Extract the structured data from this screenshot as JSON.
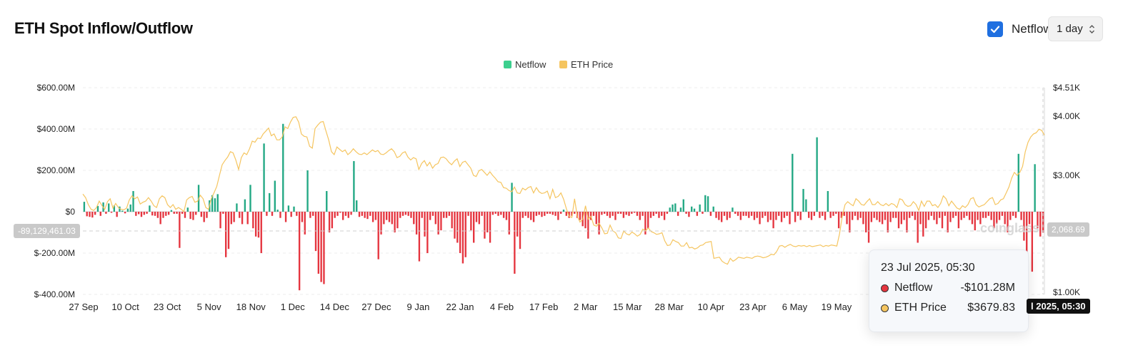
{
  "header": {
    "title": "ETH Spot Inflow/Outflow",
    "netflow_toggle_label": "Netflow",
    "netflow_toggle_checked": true,
    "interval_value": "1 day"
  },
  "chart_data": {
    "type": "bar",
    "legend": [
      "Netflow",
      "ETH Price"
    ],
    "legend_position": "top-center",
    "colors": {
      "inflow": "#22a884",
      "outflow": "#e5353f",
      "price": "#f5c560",
      "legend_netflow": "#3ccf8e",
      "legend_price": "#f5c560"
    },
    "grid": true,
    "watermark": "coinglass",
    "y_left": {
      "ticks": [
        "$600.00M",
        "$400.00M",
        "$200.00M",
        "$0",
        "$-200.00M",
        "$-400.00M"
      ],
      "ylim": [
        -400,
        600
      ],
      "unit": "$M"
    },
    "y_right": {
      "ticks": [
        "$4.51K",
        "$4.00K",
        "$3.00K",
        "$1.00K"
      ],
      "tick_values": [
        4510,
        4000,
        3000,
        1000
      ]
    },
    "x_ticks": [
      "27 Sep",
      "10 Oct",
      "23 Oct",
      "5 Nov",
      "18 Nov",
      "1 Dec",
      "14 Dec",
      "27 Dec",
      "9 Jan",
      "22 Jan",
      "4 Feb",
      "17 Feb",
      "2 Mar",
      "15 Mar",
      "28 Mar",
      "10 Apr",
      "23 Apr",
      "6 May",
      "19 May"
    ],
    "netflow_millions": [
      48,
      -22,
      -25,
      -28,
      -15,
      28,
      -20,
      45,
      -10,
      40,
      -5,
      30,
      -25,
      25,
      5,
      -8,
      15,
      35,
      100,
      -20,
      -12,
      -25,
      -15,
      -10,
      30,
      -18,
      -20,
      -30,
      -60,
      -30,
      -20,
      -15,
      8,
      -10,
      -10,
      -175,
      -10,
      -30,
      20,
      -35,
      -40,
      -15,
      130,
      -25,
      -50,
      -30,
      55,
      80,
      65,
      85,
      -80,
      -10,
      -220,
      -180,
      -60,
      -50,
      40,
      -30,
      -60,
      60,
      -60,
      130,
      -80,
      -120,
      -125,
      -200,
      330,
      -20,
      90,
      -20,
      150,
      10,
      -30,
      425,
      -50,
      30,
      -25,
      25,
      -20,
      -380,
      -50,
      -110,
      200,
      -30,
      -20,
      -190,
      -300,
      -340,
      -350,
      100,
      -100,
      -80,
      -30,
      -20,
      -5,
      -40,
      -20,
      -30,
      -15,
      245,
      55,
      -25,
      -20,
      -30,
      -35,
      -20,
      -50,
      -40,
      -230,
      -110,
      -60,
      -40,
      -50,
      -60,
      -100,
      -80,
      -30,
      -20,
      -15,
      -20,
      -30,
      -60,
      -110,
      -240,
      -30,
      -120,
      -200,
      -40,
      -20,
      -60,
      -110,
      -90,
      -30,
      -30,
      -20,
      -80,
      -130,
      -150,
      -200,
      -250,
      -220,
      -20,
      -90,
      -150,
      -50,
      -60,
      -20,
      -130,
      -100,
      -150,
      -15,
      -10,
      -20,
      -15,
      -30,
      -40,
      -110,
      140,
      -300,
      -120,
      -180,
      -30,
      -20,
      -30,
      -40,
      -50,
      -20,
      -15,
      -25,
      -20,
      -10,
      -10,
      -15,
      -20,
      -40,
      -10,
      10,
      -20,
      -30,
      -20,
      -10,
      -30,
      -40,
      -70,
      -80,
      -130,
      -40,
      -20,
      -60,
      -110,
      -15,
      -10,
      -20,
      -30,
      -20,
      -40,
      -10,
      -10,
      -30,
      -15,
      -20,
      -10,
      -5,
      -20,
      -40,
      -20,
      -110,
      -80,
      -30,
      -20,
      -10,
      -30,
      -20,
      -40,
      -10,
      20,
      35,
      40,
      -20,
      20,
      60,
      -10,
      -25,
      25,
      15,
      -20,
      35,
      -10,
      80,
      75,
      -20,
      25,
      -30,
      -40,
      -50,
      -20,
      -40,
      -30,
      20,
      -10,
      -20,
      -40,
      -20,
      -20,
      -30,
      -20,
      -40,
      -30,
      -60,
      -30,
      -20,
      -50,
      -40,
      -80,
      -40,
      -20,
      -50,
      -30,
      -20,
      -60,
      280,
      -50,
      -20,
      -40,
      110,
      60,
      -30,
      -40,
      -20,
      360,
      -30,
      -20,
      -40,
      100,
      -30,
      -20,
      -10,
      -80,
      -30,
      -20,
      -60,
      -100,
      -40,
      -20,
      -40,
      -30,
      -60,
      -100,
      -150,
      -50,
      -30,
      -40,
      -50,
      -60,
      -40,
      -100,
      -50,
      -30,
      -30,
      -80,
      -60,
      -40,
      -100,
      -30,
      -20,
      -40,
      -150,
      -60,
      -120,
      -80,
      -40,
      -20,
      -40,
      -60,
      -30,
      -80,
      -20,
      -100,
      -50,
      -30,
      -20,
      -80,
      -40,
      -30,
      -20,
      -40,
      -60,
      -90,
      -40,
      -60,
      -30,
      -30,
      -20,
      -40,
      -80,
      -60,
      -40,
      -20,
      -60,
      -100,
      -40,
      -20,
      -30,
      280,
      -40,
      -140,
      -200,
      -60,
      -290,
      230,
      -80,
      -120,
      -101
    ],
    "eth_price_usd": [
      2680,
      2620,
      2500,
      2420,
      2400,
      2450,
      2560,
      2480,
      2420,
      2550,
      2600,
      2440,
      2520,
      2450,
      2420,
      2410,
      2440,
      2580,
      2650,
      2600,
      2630,
      2510,
      2540,
      2560,
      2620,
      2560,
      2480,
      2450,
      2600,
      2650,
      2620,
      2500,
      2450,
      2500,
      2420,
      2450,
      2420,
      2380,
      2580,
      2620,
      2640,
      2540,
      2560,
      2660,
      2600,
      2450,
      2420,
      2600,
      2700,
      2810,
      3000,
      3180,
      3250,
      3310,
      3400,
      3380,
      3260,
      3100,
      3300,
      3380,
      3350,
      3450,
      3580,
      3560,
      3630,
      3620,
      3700,
      3750,
      3800,
      3670,
      3700,
      3600,
      3600,
      3650,
      3820,
      3790,
      3900,
      3980,
      3990,
      3900,
      3700,
      3660,
      3650,
      3490,
      3460,
      3790,
      3850,
      3900,
      3910,
      3750,
      3600,
      3400,
      3350,
      3480,
      3440,
      3400,
      3430,
      3350,
      3390,
      3450,
      3400,
      3360,
      3350,
      3380,
      3350,
      3390,
      3430,
      3400,
      3420,
      3360,
      3350,
      3380,
      3420,
      3450,
      3400,
      3300,
      3320,
      3380,
      3400,
      3310,
      3260,
      3300,
      3280,
      3100,
      3200,
      3250,
      3160,
      3220,
      3120,
      3180,
      3200,
      3300,
      3310,
      3280,
      3220,
      3180,
      3240,
      3280,
      3150,
      3220,
      3240,
      3180,
      3120,
      3000,
      2980,
      3080,
      3100,
      3050,
      3000,
      3060,
      3000,
      2950,
      2890,
      2880,
      2790,
      2780,
      2740,
      2720,
      2800,
      2700,
      2690,
      2780,
      2750,
      2790,
      2810,
      2700,
      2790,
      2720,
      2690,
      2700,
      2730,
      2600,
      2760,
      2620,
      2640,
      2700,
      2590,
      2430,
      2300,
      2280,
      2600,
      2300,
      2200,
      2250,
      2480,
      2250,
      2300,
      2150,
      2130,
      2180,
      2100,
      2000,
      2010,
      2150,
      2050,
      2020,
      1930,
      1920,
      2050,
      2000,
      1980,
      2030,
      2000,
      1960,
      1990,
      2080,
      2050,
      2100,
      2040,
      2020,
      1990,
      2000,
      2020,
      1880,
      1800,
      1810,
      1900,
      1870,
      1850,
      1790,
      1790,
      1850,
      1760,
      1770,
      1740,
      1760,
      1800,
      1810,
      1850,
      1860,
      1870,
      1580,
      1590,
      1600,
      1530,
      1500,
      1480,
      1580,
      1530,
      1560,
      1600,
      1590,
      1580,
      1600,
      1590,
      1580,
      1610,
      1620,
      1610,
      1590,
      1600,
      1620,
      1650,
      1640,
      1700,
      1790,
      1800,
      1770,
      1800,
      1820,
      1790,
      1780,
      1800,
      1790,
      1800,
      1780,
      1800,
      1780,
      1790,
      1800,
      1810,
      1780,
      1800,
      1790,
      1810,
      1800,
      1790,
      2000,
      2300,
      2500,
      2550,
      2510,
      2480,
      2600,
      2560,
      2500,
      2490,
      2550,
      2600,
      2500,
      2500,
      2550,
      2500,
      2480,
      2520,
      2480,
      2520,
      2500,
      2450,
      2600,
      2580,
      2500,
      2470,
      2480,
      2550,
      2500,
      2400,
      2560,
      2470,
      2560,
      2560,
      2480,
      2500,
      2450,
      2520,
      2650,
      2600,
      2480,
      2560,
      2500,
      2440,
      2420,
      2480,
      2450,
      2500,
      2600,
      2620,
      2500,
      2460,
      2480,
      2500,
      2550,
      2600,
      2620,
      2500,
      2520,
      2580,
      2600,
      2700,
      2800,
      2950,
      3050,
      3000,
      3050,
      3150,
      3400,
      3560,
      3650,
      3700,
      3720,
      3780,
      3760,
      3680
    ]
  },
  "tooltip": {
    "time": "23 Jul 2025, 05:30",
    "rows": [
      {
        "label": "Netflow",
        "value": "-$101.28M",
        "dot_color": "#e5353f"
      },
      {
        "label": "ETH Price",
        "value": "$3679.83",
        "dot_color": "#f5c560"
      }
    ]
  },
  "crosshair": {
    "left_value": "-89,129,461.03",
    "right_value": "2,068.69",
    "time_label": "l 2025, 05:30"
  }
}
